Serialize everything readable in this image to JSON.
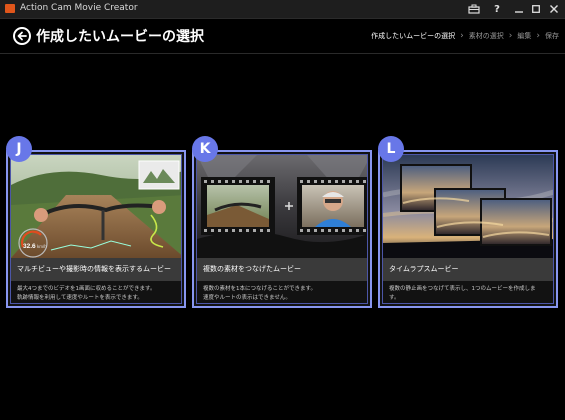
{
  "window": {
    "title": "Action Cam Movie Creator"
  },
  "header": {
    "title": "作成したいムービーの選択",
    "breadcrumb": [
      "作成したいムービーの選択",
      "素材の選択",
      "編集",
      "保存"
    ]
  },
  "cards": [
    {
      "badge": "J",
      "title": "マルチビューや撮影時の情報を表示するムービー",
      "desc": [
        "最大4つまでのビデオを1画面に収めることができます。",
        "軌跡情報を利用して速度やルートを表示できます。"
      ],
      "speed": "32.6",
      "speed_unit": "km/h"
    },
    {
      "badge": "K",
      "title": "複数の素材をつなげたムービー",
      "desc": [
        "複数の素材を1本につなげることができます。",
        "速度やルートの表示はできません。"
      ]
    },
    {
      "badge": "L",
      "title": "タイムラプスムービー",
      "desc": [
        "複数の静止画をつなげて表示し、1つのムービーを作成しま",
        "す。"
      ]
    }
  ],
  "colors": {
    "accent": "#6877e8",
    "card_border": "#8896f0",
    "title_bar": "#3a3a3a",
    "app_icon": "#e0561b"
  }
}
